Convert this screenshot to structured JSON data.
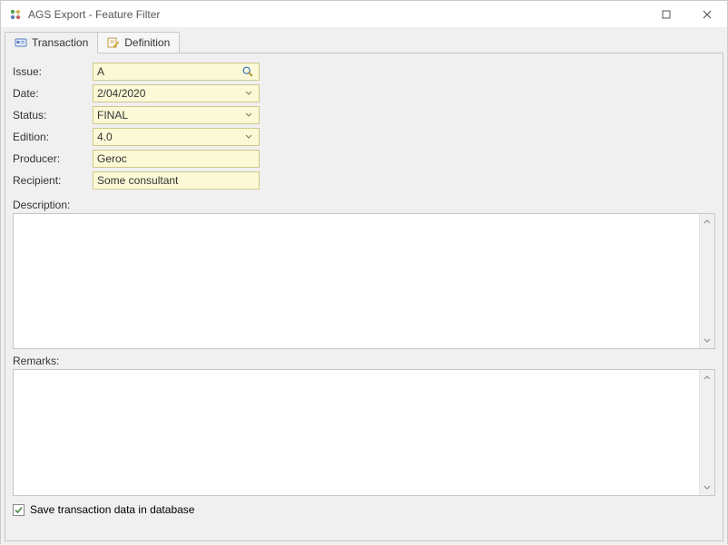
{
  "window": {
    "title": "AGS Export - Feature Filter"
  },
  "tabs": {
    "transaction": "Transaction",
    "definition": "Definition"
  },
  "form": {
    "issue": {
      "label": "Issue:",
      "value": "A"
    },
    "date": {
      "label": "Date:",
      "value": "2/04/2020"
    },
    "status": {
      "label": "Status:",
      "value": "FINAL"
    },
    "edition": {
      "label": "Edition:",
      "value": "4.0"
    },
    "producer": {
      "label": "Producer:",
      "value": "Geroc"
    },
    "recipient": {
      "label": "Recipient:",
      "value": "Some consultant"
    }
  },
  "description": {
    "label": "Description:",
    "value": ""
  },
  "remarks": {
    "label": "Remarks:",
    "value": ""
  },
  "footer": {
    "save_label": "Save transaction data in database",
    "save_checked": true
  }
}
